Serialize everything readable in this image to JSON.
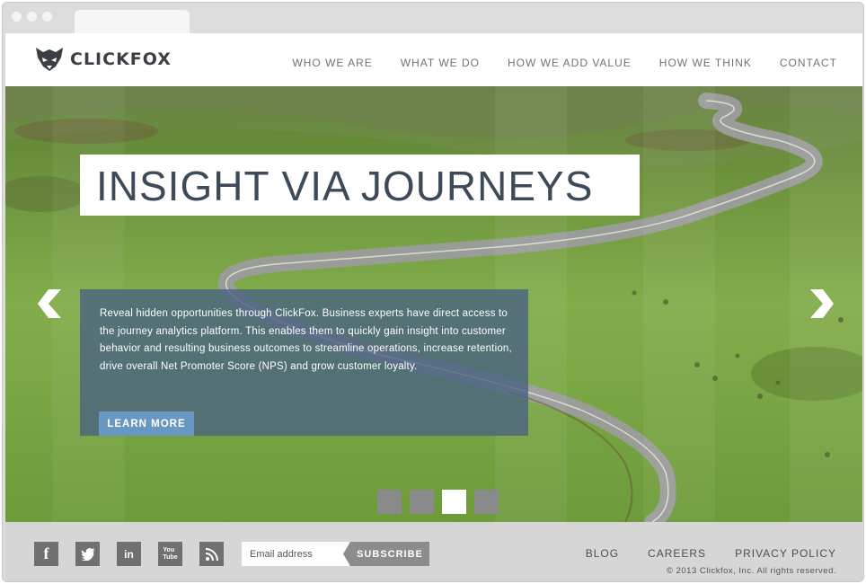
{
  "brand": {
    "name": "CLICKFOX"
  },
  "nav": {
    "items": [
      "WHO WE ARE",
      "WHAT WE DO",
      "HOW WE ADD VALUE",
      "HOW WE THINK",
      "CONTACT"
    ]
  },
  "hero": {
    "headline": "INSIGHT VIA JOURNEYS",
    "description": "Reveal hidden opportunities through ClickFox. Business experts have direct access to the journey analytics platform.   This enables them to quickly gain insight into customer behavior and resulting business outcomes to streamline operations, increase retention, drive overall Net Promoter Score (NPS) and grow customer loyalty.",
    "cta_label": "LEARN MORE",
    "slides_total": 4,
    "active_slide": 3
  },
  "footer": {
    "social": [
      {
        "icon": "facebook-icon",
        "glyph": "f"
      },
      {
        "icon": "twitter-icon",
        "glyph": "t"
      },
      {
        "icon": "linkedin-icon",
        "glyph": "in"
      },
      {
        "icon": "youtube-icon",
        "glyph": "You"
      },
      {
        "icon": "rss-icon",
        "glyph": "rss"
      }
    ],
    "email_placeholder": "Email address",
    "subscribe_label": "SUBSCRIBE",
    "links": [
      "BLOG",
      "CAREERS",
      "PRIVACY POLICY"
    ],
    "copyright": "© 2013 Clickfox, Inc. All rights reserved."
  },
  "colors": {
    "nav_text": "#6e7378",
    "headline": "#3c4a5a",
    "cta": "#6897c1",
    "overlay": "#4a6480",
    "footer_bg": "#d6d6d6"
  }
}
